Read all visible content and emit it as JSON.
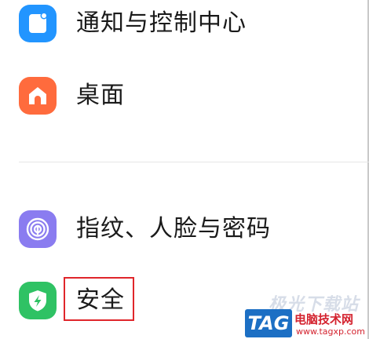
{
  "settings_list": {
    "items": [
      {
        "label": "通知与控制中心",
        "icon": "notification-control-icon",
        "color": "#2295ff"
      },
      {
        "label": "桌面",
        "icon": "home-icon",
        "color": "#ff6b3d"
      },
      {
        "label": "指纹、人脸与密码",
        "icon": "fingerprint-icon",
        "color": "#8a7cf0"
      },
      {
        "label": "安全",
        "icon": "shield-icon",
        "color": "#2fc264"
      }
    ]
  },
  "annotation": {
    "highlight_color": "#e0262b"
  },
  "watermark": {
    "text": "极光下载站",
    "logo": "TAG",
    "site_name": "电脑技术网",
    "url": "www.tagxp.com"
  }
}
